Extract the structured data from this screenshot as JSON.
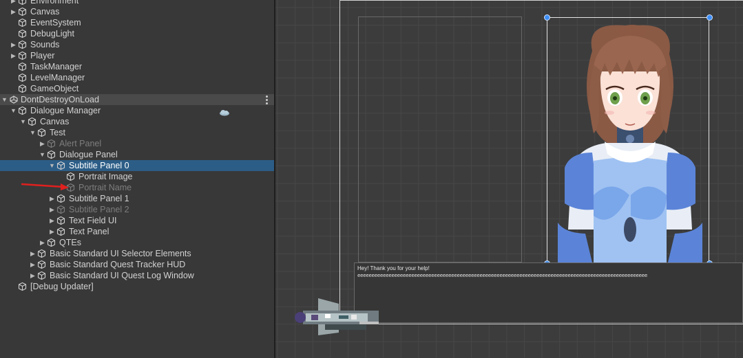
{
  "hierarchy": {
    "rows": [
      {
        "label": "Environment",
        "depth": 0,
        "arrow": "right",
        "style": "normal"
      },
      {
        "label": "Canvas",
        "depth": 0,
        "arrow": "right",
        "style": "normal"
      },
      {
        "label": "EventSystem",
        "depth": 0,
        "arrow": "none",
        "style": "normal"
      },
      {
        "label": "DebugLight",
        "depth": 0,
        "arrow": "none",
        "style": "normal"
      },
      {
        "label": "Sounds",
        "depth": 0,
        "arrow": "right",
        "style": "normal"
      },
      {
        "label": "Player",
        "depth": 0,
        "arrow": "right",
        "style": "normal"
      },
      {
        "label": "TaskManager",
        "depth": 0,
        "arrow": "none",
        "style": "normal"
      },
      {
        "label": "LevelManager",
        "depth": 0,
        "arrow": "none",
        "style": "normal"
      },
      {
        "label": "GameObject",
        "depth": 0,
        "arrow": "none",
        "style": "normal"
      },
      {
        "label": "DontDestroyOnLoad",
        "depth": 0,
        "arrow": "down",
        "style": "scene"
      },
      {
        "label": "Dialogue Manager",
        "depth": 0,
        "arrow": "down",
        "style": "normal"
      },
      {
        "label": "Canvas",
        "depth": 1,
        "arrow": "down",
        "style": "normal"
      },
      {
        "label": "Test",
        "depth": 2,
        "arrow": "down",
        "style": "normal"
      },
      {
        "label": "Alert Panel",
        "depth": 3,
        "arrow": "right",
        "style": "dim"
      },
      {
        "label": "Dialogue Panel",
        "depth": 3,
        "arrow": "down",
        "style": "normal"
      },
      {
        "label": "Subtitle Panel 0",
        "depth": 4,
        "arrow": "down",
        "style": "selected"
      },
      {
        "label": "Portrait Image",
        "depth": 5,
        "arrow": "none",
        "style": "normal"
      },
      {
        "label": "Portrait Name",
        "depth": 5,
        "arrow": "none",
        "style": "dim"
      },
      {
        "label": "Subtitle Panel 1",
        "depth": 4,
        "arrow": "right",
        "style": "normal"
      },
      {
        "label": "Subtitle Panel 2",
        "depth": 4,
        "arrow": "right",
        "style": "dim"
      },
      {
        "label": "Text Field UI",
        "depth": 4,
        "arrow": "right",
        "style": "normal"
      },
      {
        "label": "Text Panel",
        "depth": 4,
        "arrow": "right",
        "style": "normal"
      },
      {
        "label": "QTEs",
        "depth": 3,
        "arrow": "right",
        "style": "normal"
      },
      {
        "label": "Basic Standard UI Selector Elements",
        "depth": 2,
        "arrow": "right",
        "style": "normal"
      },
      {
        "label": "Basic Standard Quest Tracker HUD",
        "depth": 2,
        "arrow": "right",
        "style": "normal"
      },
      {
        "label": "Basic Standard UI Quest Log Window",
        "depth": 2,
        "arrow": "right",
        "style": "normal"
      },
      {
        "label": "[Debug Updater]",
        "depth": 0,
        "arrow": "none",
        "style": "normal"
      }
    ]
  },
  "scene": {
    "subtitle_line1": "Hey! Thank you for your help!",
    "subtitle_line2": "eeeeeeeeeeeeeeeeeeeeeeeeeeeeeeeeeeeeeeeeeeeeeeeeeeeeeeeeeeeeeeeeeeeeeeeeeeeeeeeeeeeeeeeeeeeeeeeeeeeeee",
    "handle_color": "#3e8ef7",
    "selection_color": "#2c5d87",
    "annotation_color": "#e0201e"
  }
}
